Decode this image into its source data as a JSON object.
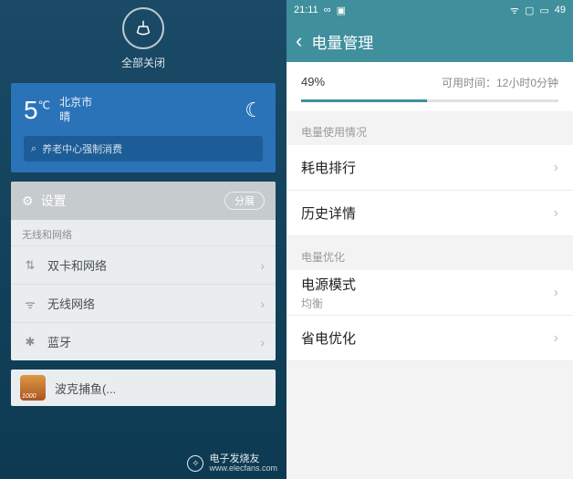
{
  "left": {
    "close_all": "全部关闭",
    "weather": {
      "temp": "5",
      "unit": "℃",
      "city": "北京市",
      "condition": "晴"
    },
    "search_placeholder": "养老中心强制消费",
    "settings_card": {
      "title": "设置",
      "pill": "分展",
      "section_label": "无线和网络",
      "items": [
        {
          "icon_name": "sim-icon",
          "glyph": "⇅",
          "label": "双卡和网络"
        },
        {
          "icon_name": "wifi-icon",
          "glyph": "ᯤ",
          "label": "无线网络"
        },
        {
          "icon_name": "bluetooth-icon",
          "glyph": "✱",
          "label": "蓝牙"
        }
      ]
    },
    "game_card": {
      "title": "波克捕鱼(..."
    }
  },
  "right": {
    "status": {
      "time": "21:11",
      "battery": "49"
    },
    "title": "电量管理",
    "percent": "49%",
    "avail_label": "可用时间：",
    "avail_value": "12小时0分钟",
    "group_usage": "电量使用情况",
    "item_rank": "耗电排行",
    "item_history": "历史详情",
    "group_opt": "电量优化",
    "item_mode": "电源模式",
    "item_mode_sub": "均衡",
    "item_save": "省电优化"
  },
  "watermark": {
    "brand": "电子发烧友",
    "url": "www.elecfans.com"
  }
}
